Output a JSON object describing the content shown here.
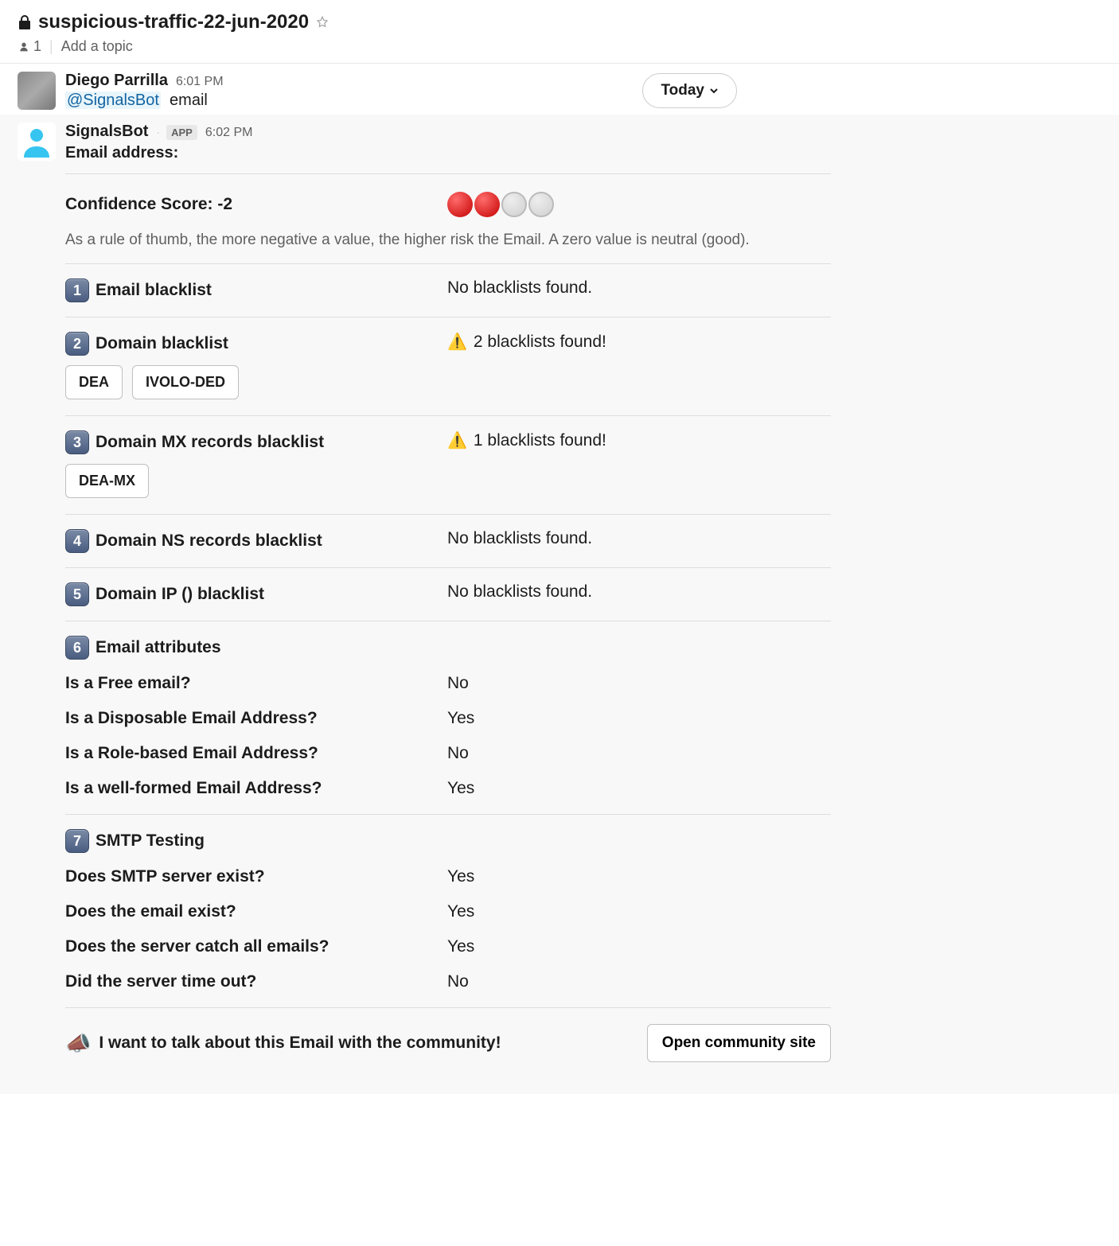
{
  "header": {
    "channel_name": "suspicious-traffic-22-jun-2020",
    "member_count": "1",
    "add_topic": "Add a topic"
  },
  "today_label": "Today",
  "msg1": {
    "author": "Diego Parrilla",
    "time": "6:01 PM",
    "mention": "@SignalsBot",
    "text_after": "email"
  },
  "msg2": {
    "author": "SignalsBot",
    "app_badge": "APP",
    "time": "6:02 PM",
    "section_label": "Email address:"
  },
  "score": {
    "label": "Confidence Score: -2",
    "rule": "As a rule of thumb, the more negative a value, the higher risk the Email. A zero value is neutral (good)."
  },
  "items": {
    "i1": {
      "num": "1",
      "title": "Email blacklist",
      "status": "No blacklists found."
    },
    "i2": {
      "num": "2",
      "title": "Domain blacklist",
      "status": "2 blacklists found!",
      "chip1": "DEA",
      "chip2": "IVOLO-DED"
    },
    "i3": {
      "num": "3",
      "title": "Domain MX records blacklist",
      "status": "1 blacklists found!",
      "chip1": "DEA-MX"
    },
    "i4": {
      "num": "4",
      "title": "Domain NS records blacklist",
      "status": "No blacklists found."
    },
    "i5": {
      "num": "5",
      "title": "Domain IP () blacklist",
      "status": "No blacklists found."
    },
    "i6": {
      "num": "6",
      "title": "Email attributes"
    },
    "i7": {
      "num": "7",
      "title": "SMTP Testing"
    }
  },
  "attrs6": {
    "a1": {
      "label": "Is a Free email?",
      "val": "No"
    },
    "a2": {
      "label": "Is a Disposable Email Address?",
      "val": "Yes"
    },
    "a3": {
      "label": "Is a Role-based Email Address?",
      "val": "No"
    },
    "a4": {
      "label": "Is a well-formed Email Address?",
      "val": "Yes"
    }
  },
  "attrs7": {
    "a1": {
      "label": "Does SMTP server exist?",
      "val": "Yes"
    },
    "a2": {
      "label": "Does the email exist?",
      "val": "Yes"
    },
    "a3": {
      "label": "Does the server catch all emails?",
      "val": "Yes"
    },
    "a4": {
      "label": "Did the server time out?",
      "val": "No"
    }
  },
  "community": {
    "text": "I want to talk about this Email with the community!",
    "button": "Open community site"
  }
}
